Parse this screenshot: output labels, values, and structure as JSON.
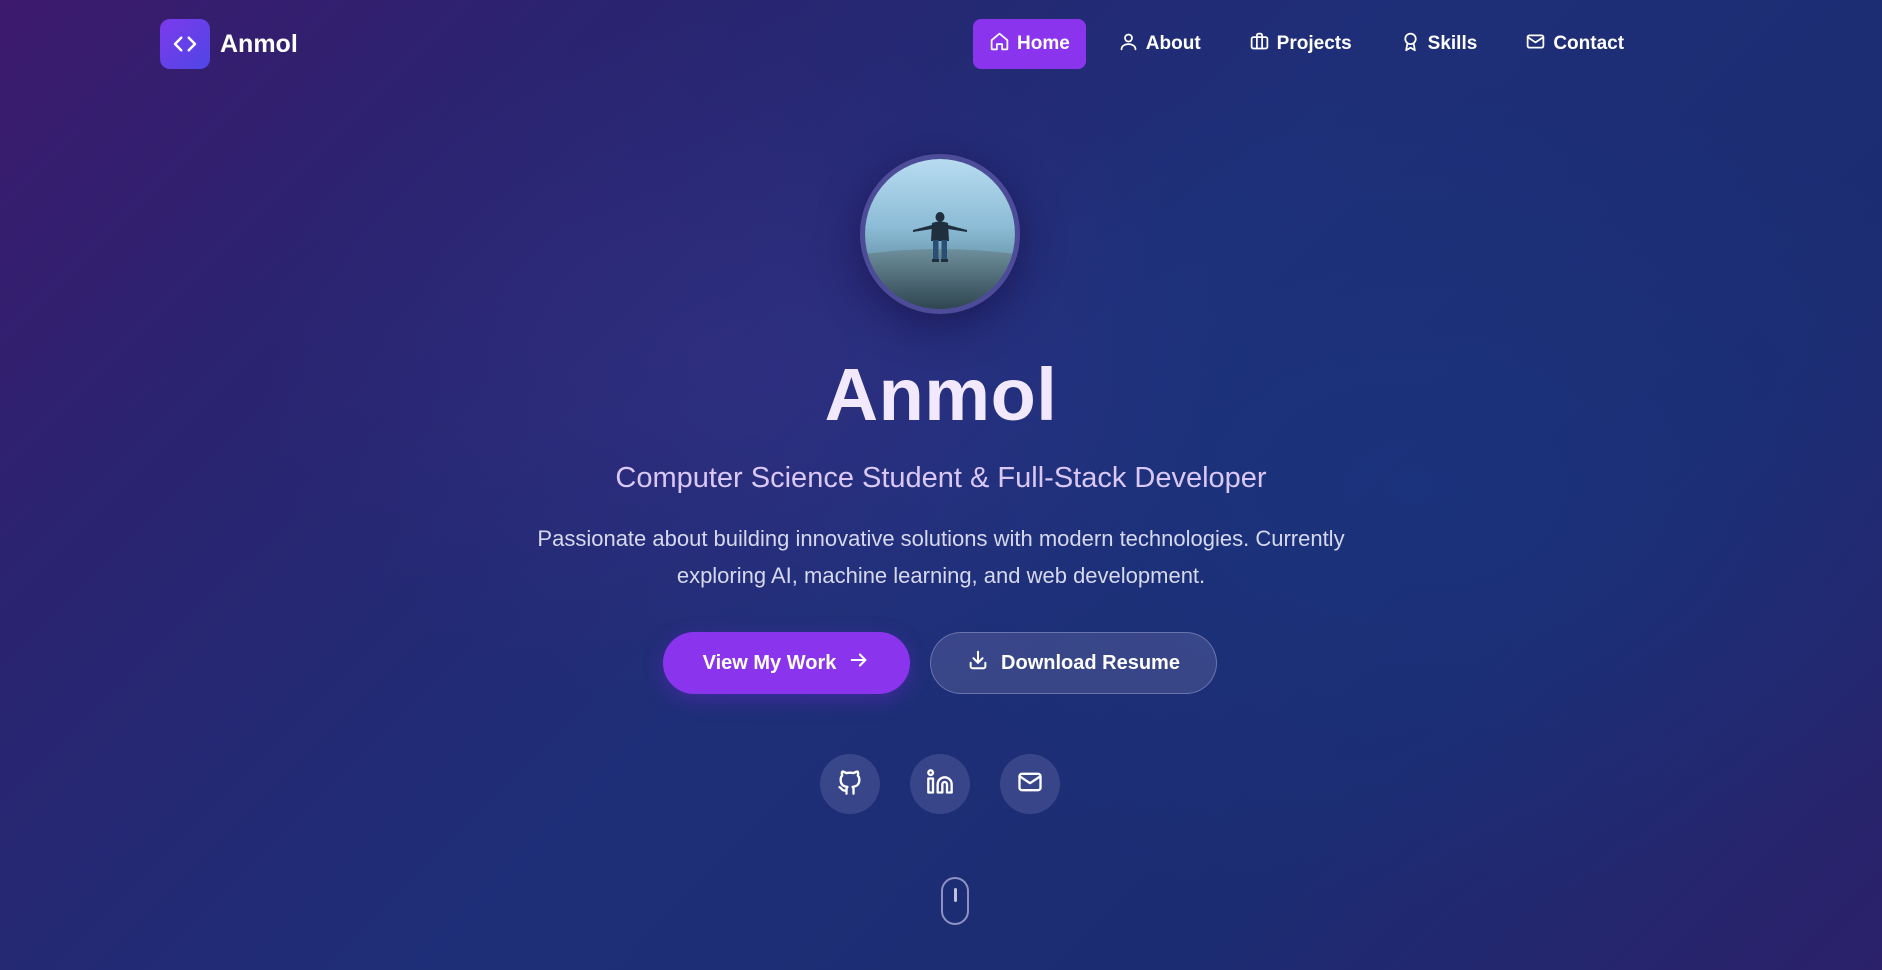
{
  "logo": {
    "text": "Anmol",
    "icon": "code-brackets-icon"
  },
  "nav": {
    "items": [
      {
        "label": "Home",
        "icon": "home-icon",
        "active": true
      },
      {
        "label": "About",
        "icon": "user-icon",
        "active": false
      },
      {
        "label": "Projects",
        "icon": "briefcase-icon",
        "active": false
      },
      {
        "label": "Skills",
        "icon": "award-icon",
        "active": false
      },
      {
        "label": "Contact",
        "icon": "mail-icon",
        "active": false
      }
    ]
  },
  "hero": {
    "name": "Anmol",
    "subtitle": "Computer Science Student & Full-Stack Developer",
    "description": "Passionate about building innovative solutions with modern technologies. Currently exploring AI, machine learning, and web development.",
    "primary_button": "View My Work",
    "secondary_button": "Download Resume"
  },
  "social": [
    {
      "icon": "github-icon"
    },
    {
      "icon": "linkedin-icon"
    },
    {
      "icon": "mail-icon"
    }
  ],
  "colors": {
    "accent": "#8b34ee",
    "name_text": "#f3e9ff",
    "subtitle_text": "#d9c8f8"
  }
}
